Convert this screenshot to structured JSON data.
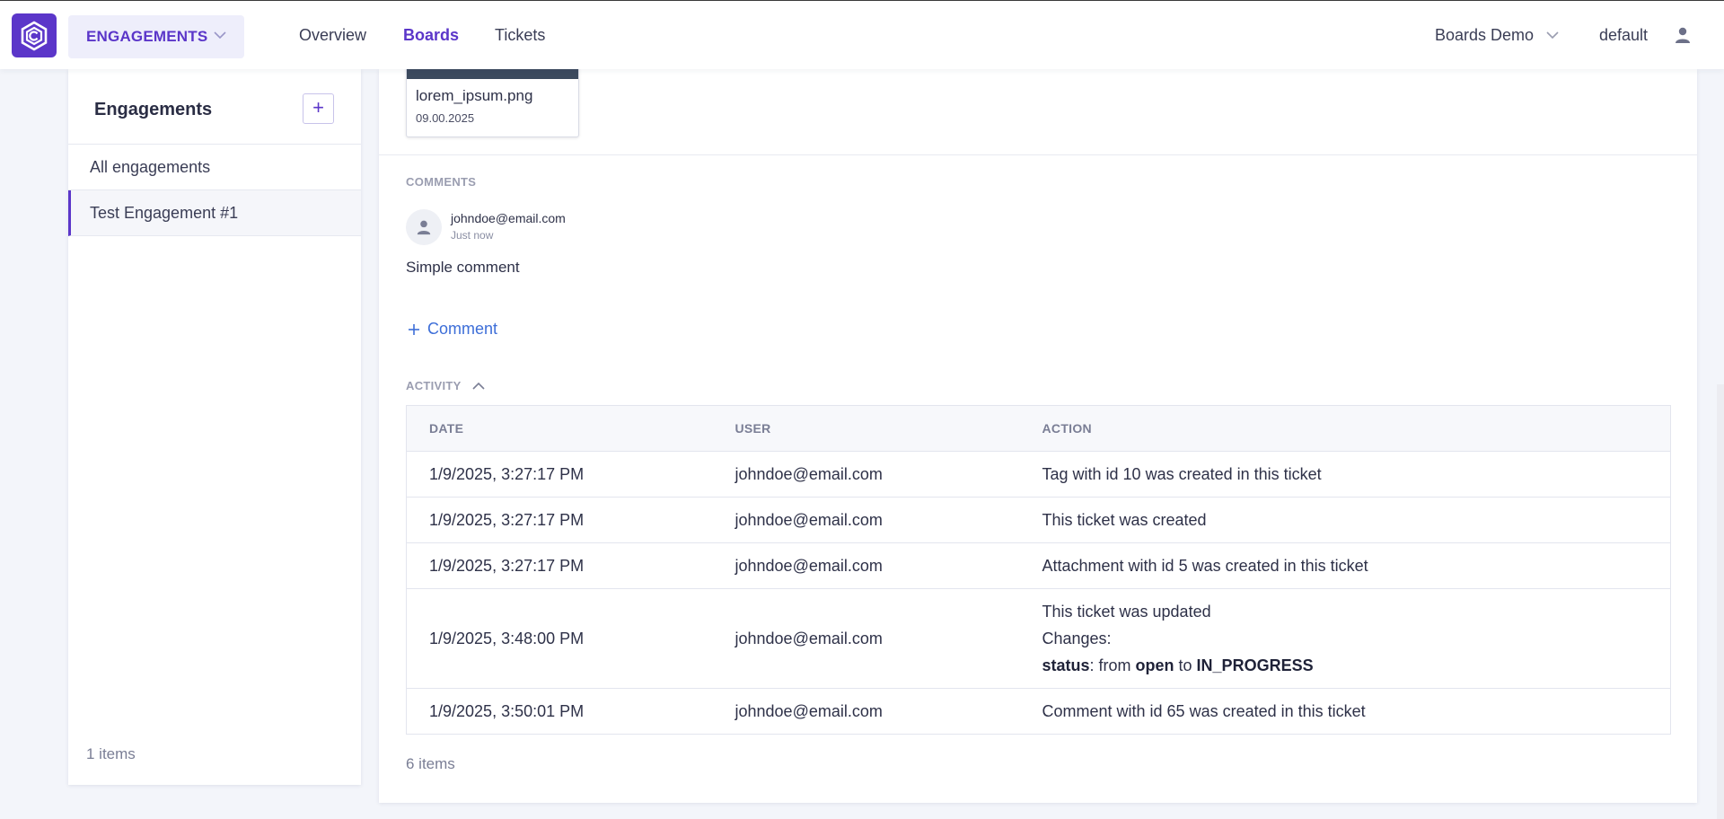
{
  "topbar": {
    "module": "ENGAGEMENTS",
    "nav": [
      "Overview",
      "Boards",
      "Tickets"
    ],
    "active_nav": "Boards",
    "board": "Boards Demo",
    "tenant": "default"
  },
  "sidebar": {
    "title": "Engagements",
    "add_label": "+",
    "items": [
      {
        "label": "All engagements",
        "selected": false
      },
      {
        "label": "Test Engagement #1",
        "selected": true
      }
    ],
    "count": "1 items"
  },
  "attachment": {
    "name": "lorem_ipsum.png",
    "date": "09.00.2025"
  },
  "comments": {
    "label": "COMMENTS",
    "items": [
      {
        "author": "johndoe@email.com",
        "time": "Just now",
        "body": "Simple comment"
      }
    ],
    "add_label": "Comment"
  },
  "activity": {
    "label": "ACTIVITY",
    "headers": [
      "DATE",
      "USER",
      "ACTION"
    ],
    "rows": [
      {
        "date": "1/9/2025, 3:27:17 PM",
        "user": "johndoe@email.com",
        "action": "Tag with id 10 was created in this ticket"
      },
      {
        "date": "1/9/2025, 3:27:17 PM",
        "user": "johndoe@email.com",
        "action": "This ticket was created"
      },
      {
        "date": "1/9/2025, 3:27:17 PM",
        "user": "johndoe@email.com",
        "action": "Attachment with id 5 was created in this ticket"
      },
      {
        "date": "1/9/2025, 3:48:00 PM",
        "user": "johndoe@email.com",
        "action": "This ticket was updated",
        "changes_label": "Changes:",
        "change": {
          "field": "status",
          "sep": ": from ",
          "from": "open",
          "to_word": " to ",
          "to": "IN_PROGRESS"
        }
      },
      {
        "date": "1/9/2025, 3:50:01 PM",
        "user": "johndoe@email.com",
        "action": "Comment with id 65 was created in this ticket"
      }
    ],
    "count": "6 items"
  },
  "colors": {
    "accent": "#5b36c9",
    "link": "#3d6ed8",
    "background": "#f3f5fa"
  },
  "icons": {
    "logo": "app-logo-hexagon-icon",
    "module_chevron": "chevron-down-icon",
    "board_chevron": "chevron-down-icon",
    "user": "user-icon",
    "avatar": "user-icon",
    "add_comment": "plus-icon",
    "activity_toggle": "chevron-up-icon"
  }
}
